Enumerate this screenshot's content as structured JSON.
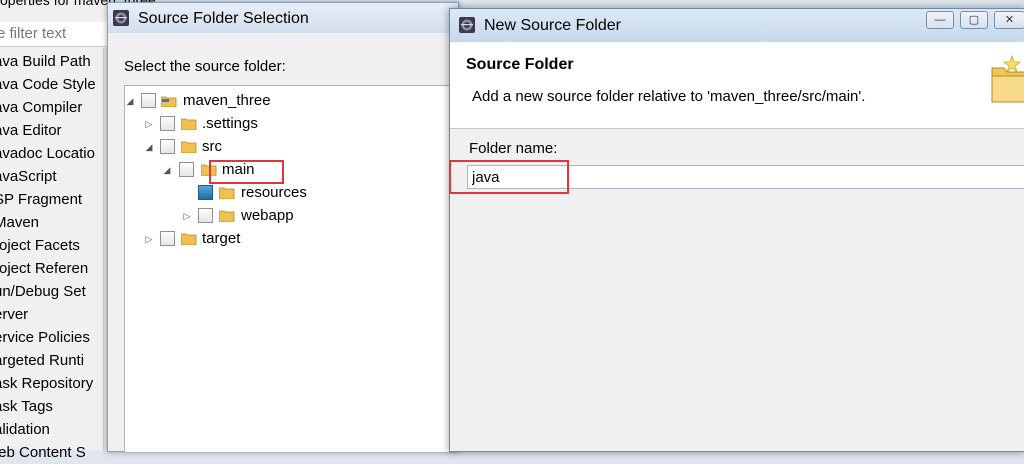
{
  "background_window": {
    "title": "operties for maven_three",
    "filter_placeholder": "e filter text",
    "items": [
      "ava Build Path",
      "ava Code Style",
      "ava Compiler",
      "ava Editor",
      "avadoc Locatio",
      "avaScript",
      "SP Fragment",
      "Maven",
      "roject Facets",
      "roject Referen",
      "un/Debug Set",
      "erver",
      "ervice Policies",
      "argeted Runti",
      "ask Repository",
      "ask Tags",
      "alidation",
      "/eb Content S"
    ]
  },
  "source_folder_selection": {
    "title": "Source Folder Selection",
    "prompt": "Select the source folder:",
    "tree": {
      "root": "maven_three",
      "settings": ".settings",
      "src": "src",
      "main": "main",
      "resources": "resources",
      "webapp": "webapp",
      "target": "target"
    }
  },
  "new_source_folder": {
    "title": "New Source Folder",
    "heading": "Source Folder",
    "description": "Add a new source folder relative to 'maven_three/src/main'.",
    "folder_name_label": "Folder name:",
    "folder_name_value": "java"
  },
  "colors": {
    "highlight": "#e0353b",
    "folder": "#f0c050"
  }
}
